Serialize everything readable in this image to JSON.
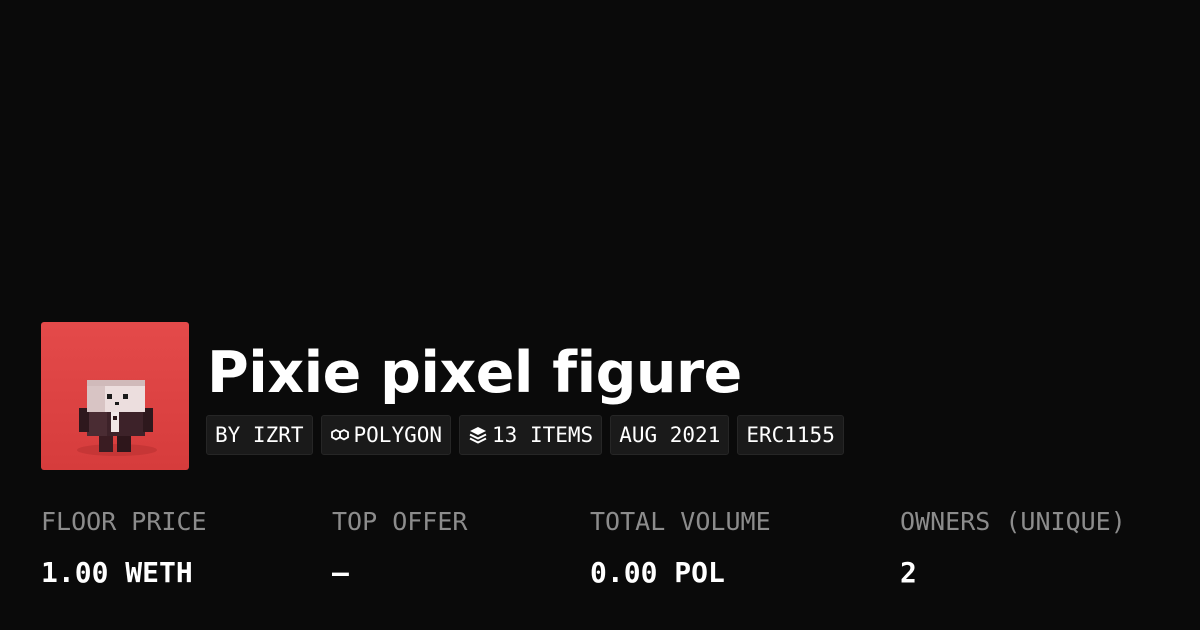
{
  "collection": {
    "title": "Pixie pixel figure",
    "image_alt": "pixel figure"
  },
  "tags": [
    {
      "icon": "",
      "label": "BY IZRT"
    },
    {
      "icon": "polygon-icon",
      "label": "POLYGON"
    },
    {
      "icon": "layers-icon",
      "label": "13 ITEMS"
    },
    {
      "icon": "",
      "label": "AUG 2021"
    },
    {
      "icon": "",
      "label": "ERC1155"
    }
  ],
  "stats": [
    {
      "label": "FLOOR PRICE",
      "value": "1.00 WETH"
    },
    {
      "label": "TOP OFFER",
      "value": "—"
    },
    {
      "label": "TOTAL VOLUME",
      "value": "0.00 POL"
    },
    {
      "label": "OWNERS (UNIQUE)",
      "value": "2"
    }
  ],
  "colors": {
    "background": "#0a0a0a",
    "thumbnail_bg": "#e04848",
    "tag_bg": "#1a1a1a",
    "label_gray": "#8c8c8c",
    "text": "#ffffff"
  }
}
